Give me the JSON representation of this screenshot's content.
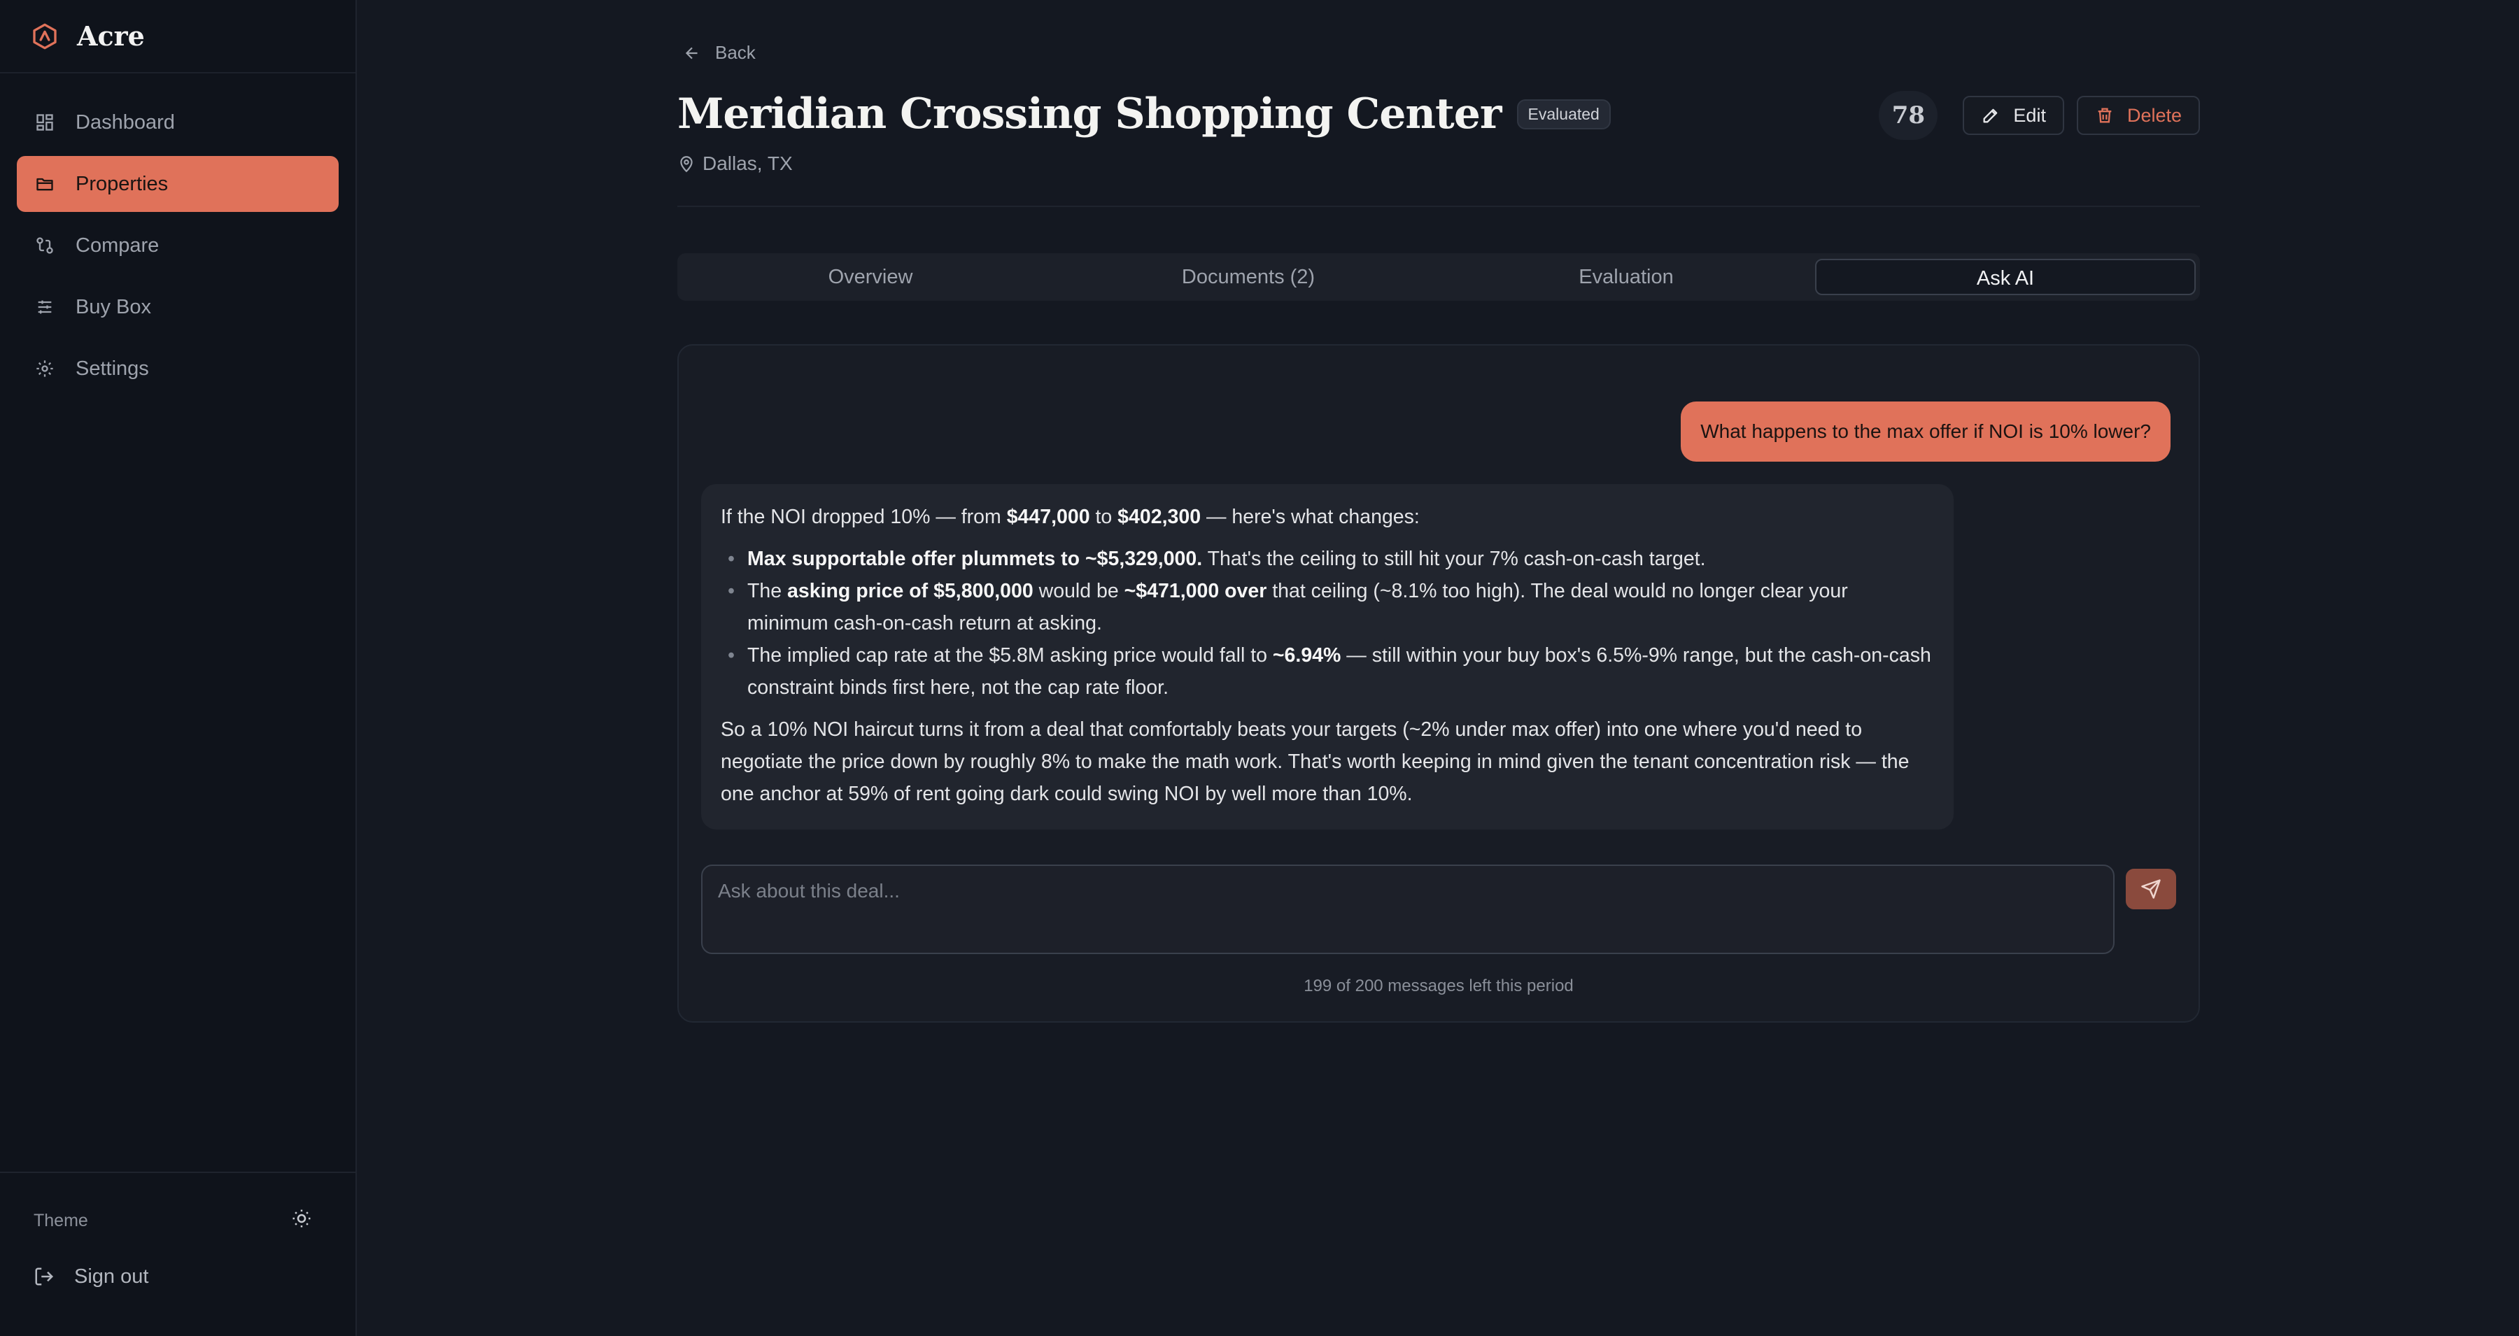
{
  "app": {
    "name": "Acre"
  },
  "sidebar": {
    "items": [
      {
        "label": "Dashboard",
        "icon": "dashboard-icon"
      },
      {
        "label": "Properties",
        "icon": "folder-icon"
      },
      {
        "label": "Compare",
        "icon": "compare-icon"
      },
      {
        "label": "Buy Box",
        "icon": "sliders-icon"
      },
      {
        "label": "Settings",
        "icon": "gear-icon"
      }
    ],
    "theme_label": "Theme",
    "signout_label": "Sign out"
  },
  "header": {
    "back_label": "Back",
    "title": "Meridian Crossing Shopping Center",
    "status_badge": "Evaluated",
    "location": "Dallas, TX",
    "score": "78",
    "edit_label": "Edit",
    "delete_label": "Delete"
  },
  "tabs": [
    {
      "label": "Overview"
    },
    {
      "label": "Documents (2)"
    },
    {
      "label": "Evaluation"
    },
    {
      "label": "Ask AI"
    }
  ],
  "chat": {
    "user_message": "What happens to the max offer if NOI is 10% lower?",
    "ai": {
      "intro_a": "If the NOI dropped 10% — from ",
      "intro_b": "$447,000",
      "intro_c": " to ",
      "intro_d": "$402,300",
      "intro_e": " — here's what changes:",
      "b1_bold": "Max supportable offer plummets to ~$5,329,000.",
      "b1_rest": " That's the ceiling to still hit your 7% cash-on-cash target.",
      "b2_a": "The ",
      "b2_b": "asking price of $5,800,000",
      "b2_c": " would be ",
      "b2_d": "~$471,000 over",
      "b2_e": " that ceiling (~8.1% too high). The deal would no longer clear your minimum cash-on-cash return at asking.",
      "b3_a": "The implied cap rate at the $5.8M asking price would fall to ",
      "b3_b": "~6.94%",
      "b3_c": " — still within your buy box's 6.5%-9% range, but the cash-on-cash constraint binds first here, not the cap rate floor.",
      "closing": "So a 10% NOI haircut turns it from a deal that comfortably beats your targets (~2% under max offer) into one where you'd need to negotiate the price down by roughly 8% to make the math work. That's worth keeping in mind given the tenant concentration risk — the one anchor at 59% of rent going dark could swing NOI by well more than 10%."
    },
    "input_placeholder": "Ask about this deal...",
    "quota": "199 of 200 messages left this period"
  },
  "colors": {
    "accent": "#e0725a",
    "background": "#141821",
    "sidebar": "#0f131b"
  }
}
